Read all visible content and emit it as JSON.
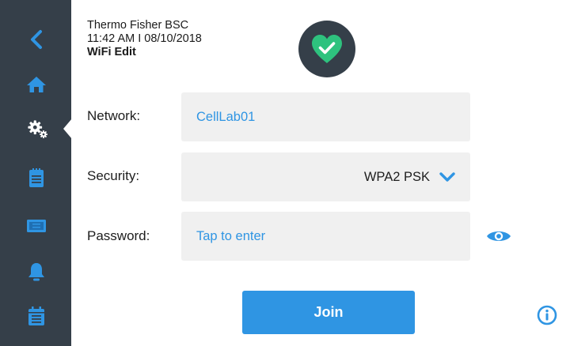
{
  "header": {
    "device_name": "Thermo Fisher BSC",
    "datetime": "11:42 AM I 08/10/2018",
    "screen_title": "WiFi Edit"
  },
  "status": {
    "icon": "heart-check-icon",
    "state": "ok"
  },
  "sidebar": {
    "items": [
      {
        "name": "back",
        "icon": "chevron-left-icon"
      },
      {
        "name": "home",
        "icon": "home-icon"
      },
      {
        "name": "settings",
        "icon": "gears-icon",
        "active": true
      },
      {
        "name": "clipboard",
        "icon": "clipboard-icon"
      },
      {
        "name": "display",
        "icon": "display-icon"
      },
      {
        "name": "alerts",
        "icon": "bell-icon"
      },
      {
        "name": "calendar",
        "icon": "calendar-icon"
      }
    ]
  },
  "form": {
    "network": {
      "label": "Network:",
      "value": "CellLab01"
    },
    "security": {
      "label": "Security:",
      "value": "WPA2 PSK"
    },
    "password": {
      "label": "Password:",
      "placeholder": "Tap to enter"
    }
  },
  "actions": {
    "join_label": "Join"
  },
  "colors": {
    "sidebar": "#353f49",
    "accent": "#2f95e3",
    "status_ok": "#2ec27e",
    "field_bg": "#f0f0f0"
  }
}
